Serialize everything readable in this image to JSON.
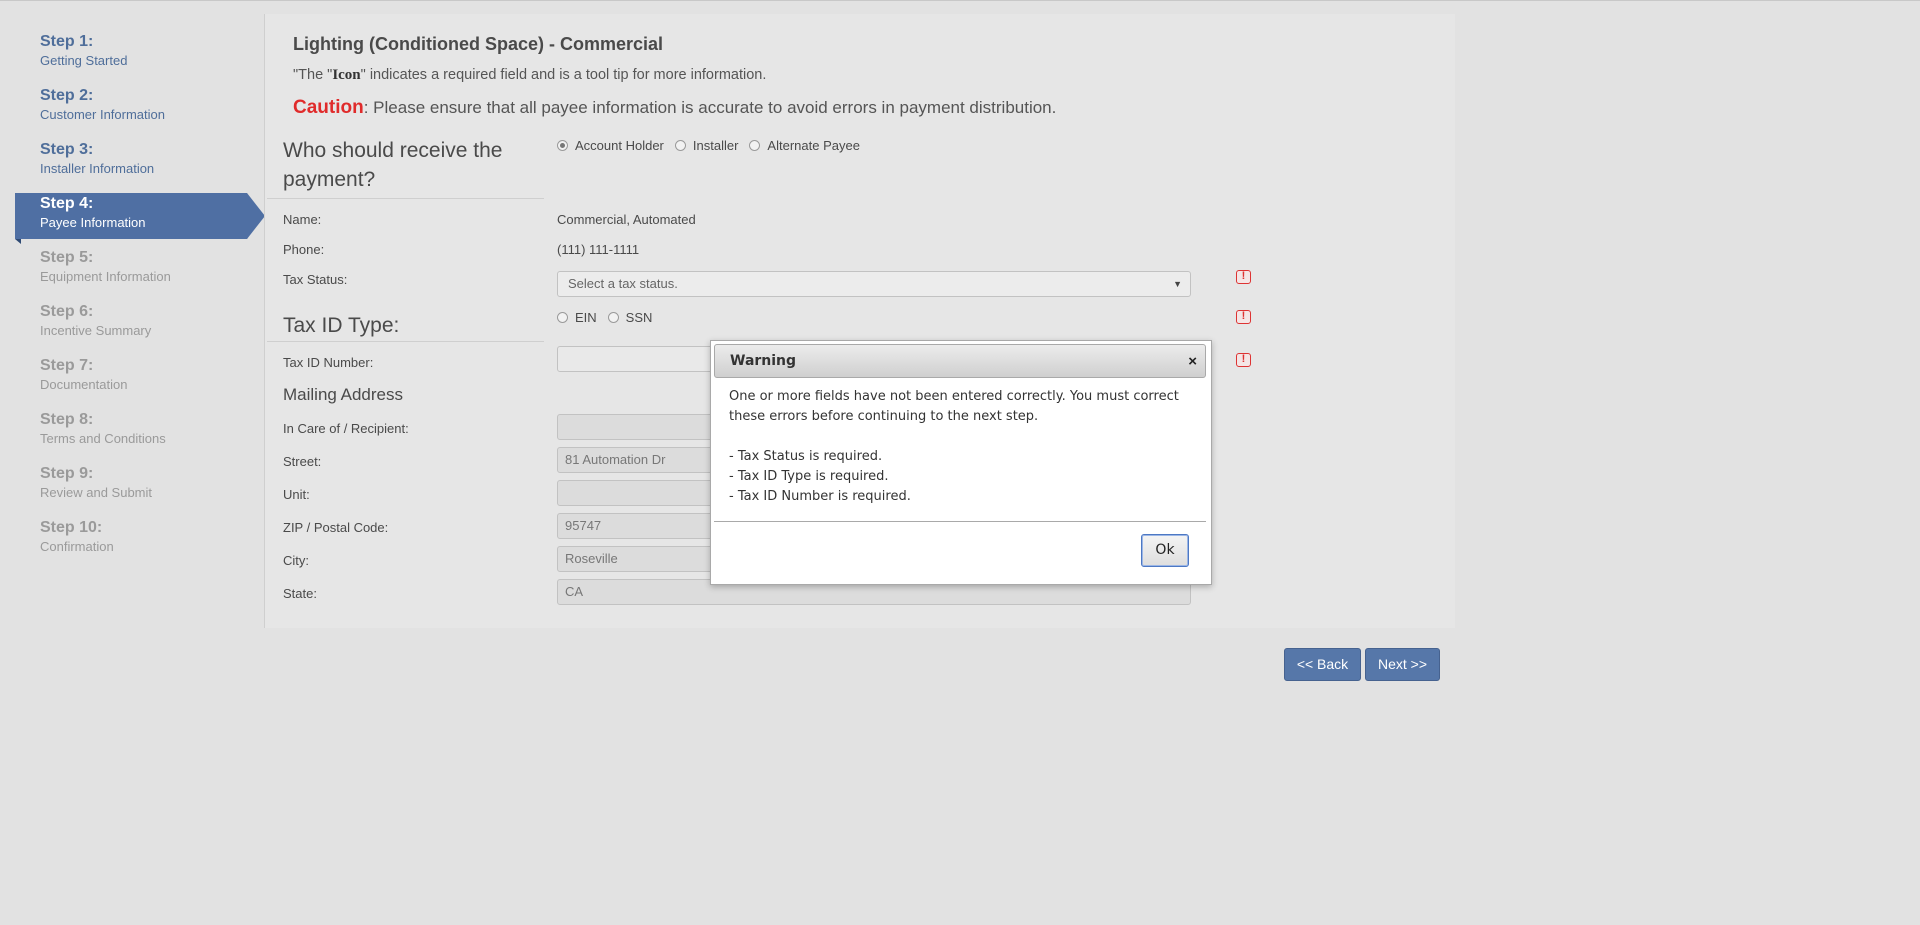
{
  "steps": [
    {
      "num": "Step 1:",
      "label": "Getting Started"
    },
    {
      "num": "Step 2:",
      "label": "Customer Information"
    },
    {
      "num": "Step 3:",
      "label": "Installer Information"
    },
    {
      "num": "Step 4:",
      "label": "Payee Information"
    },
    {
      "num": "Step 5:",
      "label": "Equipment Information"
    },
    {
      "num": "Step 6:",
      "label": "Incentive Summary"
    },
    {
      "num": "Step 7:",
      "label": "Documentation"
    },
    {
      "num": "Step 8:",
      "label": "Terms and Conditions"
    },
    {
      "num": "Step 9:",
      "label": "Review and Submit"
    },
    {
      "num": "Step 10:",
      "label": "Confirmation"
    }
  ],
  "header": {
    "title": "Lighting (Conditioned Space) - Commercial",
    "note_prefix": "\"The \"",
    "note_icon": "Icon",
    "note_suffix": "\" indicates a required field and is a tool tip for more information.",
    "caution_label": "Caution",
    "caution_text": ": Please ensure that all payee information is accurate to avoid errors in payment distribution."
  },
  "payee": {
    "question": "Who should receive the payment?",
    "options": [
      "Account Holder",
      "Installer",
      "Alternate Payee"
    ],
    "selected": "Account Holder",
    "name_label": "Name:",
    "name_value": "Commercial, Automated",
    "phone_label": "Phone:",
    "phone_value": "(111) 111-1111",
    "tax_status_label": "Tax Status:",
    "tax_status_placeholder": "Select a tax status."
  },
  "tax_id": {
    "heading": "Tax ID Type:",
    "options": [
      "EIN",
      "SSN"
    ],
    "number_label": "Tax ID Number:",
    "number_value": ""
  },
  "mailing": {
    "heading": "Mailing Address",
    "care_of_label": "In Care of / Recipient:",
    "care_of_value": "",
    "street_label": "Street:",
    "street_value": "81 Automation Dr",
    "unit_label": "Unit:",
    "unit_value": "",
    "zip_label": "ZIP / Postal Code:",
    "zip_value": "95747",
    "city_label": "City:",
    "city_value": "Roseville",
    "state_label": "State:",
    "state_value": "CA"
  },
  "required_icon": "!",
  "nav": {
    "back_label": "<< Back",
    "next_label": "Next >>"
  },
  "dialog": {
    "title": "Warning",
    "close": "×",
    "message": "One or more fields have not been entered correctly. You must correct these errors before continuing to the next step.",
    "errors": [
      "- Tax Status is required.",
      "- Tax ID Type is required.",
      "- Tax ID Number is required."
    ],
    "ok_label": "Ok"
  },
  "colors": {
    "accent": "#5677a9",
    "active_step": "#4f6fa3",
    "caution": "#e02b2b",
    "error": "#dd3333"
  }
}
